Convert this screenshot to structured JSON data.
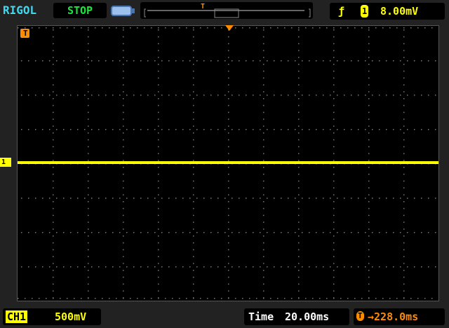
{
  "header": {
    "brand": "RIGOL",
    "status": "STOP",
    "trigger_level": "8.00mV",
    "trigger_channel": "1",
    "trigger_marker": "T"
  },
  "footer": {
    "channel": "CH1",
    "scale": "500mV",
    "time_label": "Time",
    "time_scale": "20.00ms",
    "trigger_offset": "228.0ms",
    "offset_marker": "T"
  },
  "screen": {
    "channel_marker": "1",
    "trigger_flag": "T"
  },
  "colors": {
    "ch1": "#ffff00",
    "trigger": "#ff8c00",
    "status": "#1fe43f",
    "brand": "#3fd8f0"
  }
}
